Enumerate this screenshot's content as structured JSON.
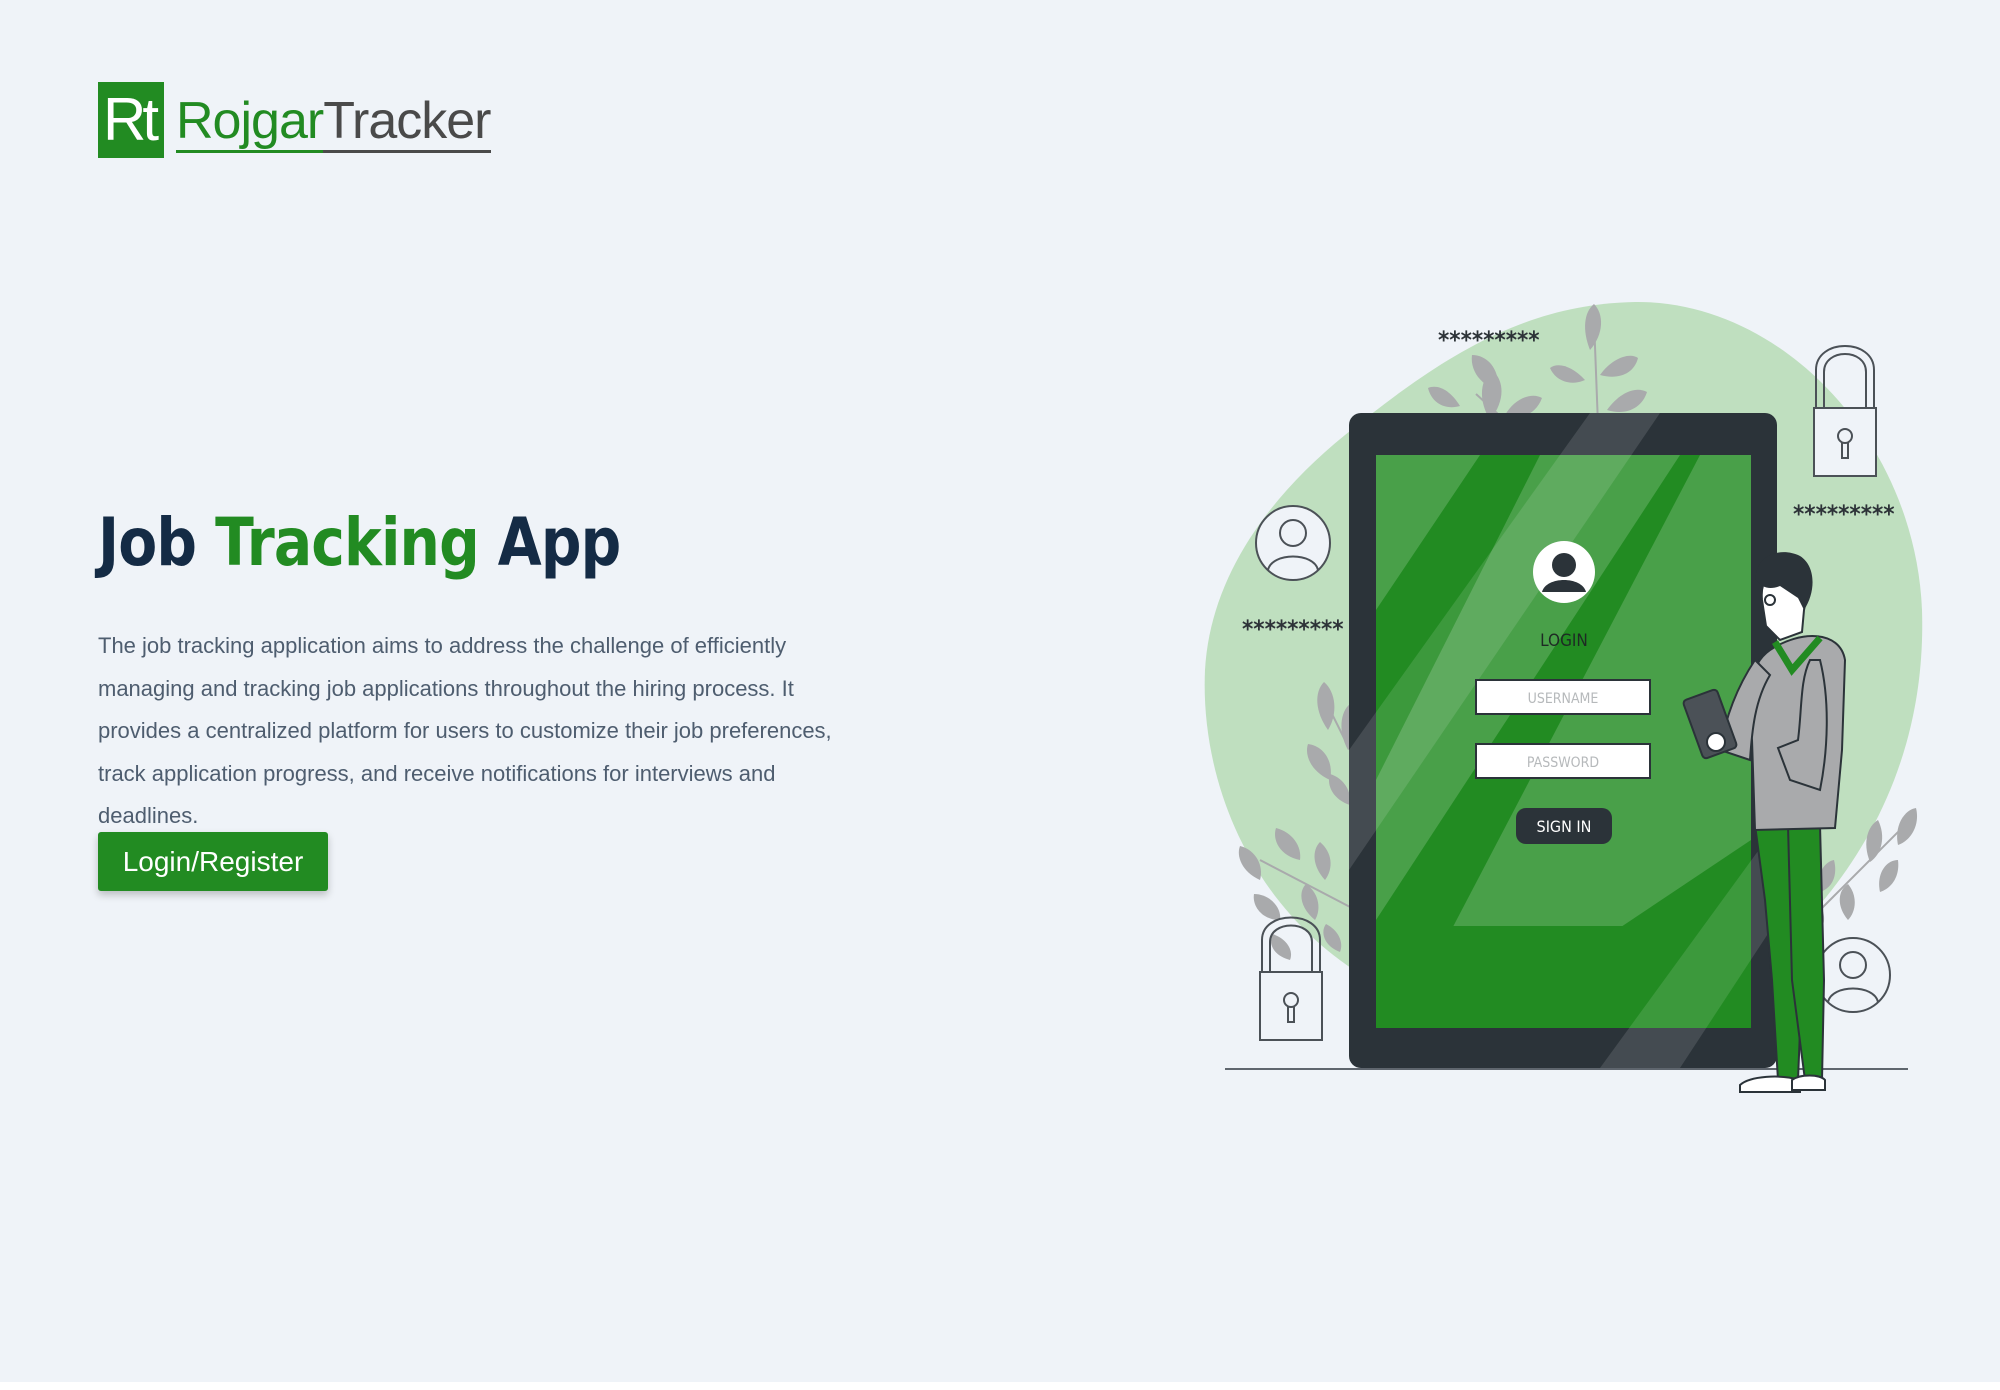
{
  "brand": {
    "mark": "Rt",
    "name_part1": "Rojgar",
    "name_part2": "Tracker",
    "colors": {
      "primary_green": "#228b22",
      "dark_navy": "#142b45",
      "page_background": "#eff3f8"
    }
  },
  "hero": {
    "title_part1": "Job",
    "title_accent": "Tracking",
    "title_part3": "App",
    "description": "The job tracking application aims to address the challenge of efficiently managing and tracking job applications throughout the hiring process. It provides a centralized platform for users to customize their job preferences, track application progress, and receive notifications for interviews and deadlines.",
    "cta_label": "Login/Register"
  },
  "illustration": {
    "screen_heading": "LOGIN",
    "username_placeholder": "USERNAME",
    "password_placeholder": "PASSWORD",
    "signin_label": "SIGN IN",
    "password_masks": [
      "*********",
      "*********",
      "*********"
    ],
    "icons": [
      "lock-icon",
      "user-avatar-icon",
      "leaf-decoration",
      "tablet-device"
    ]
  }
}
